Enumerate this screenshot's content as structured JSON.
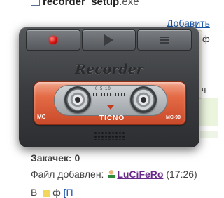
{
  "background_page": {
    "file_name": "recorder_setup",
    "file_ext": ".exe",
    "add_link": "Добавить",
    "fragment_right_1": "ф",
    "fragment_right_2": "ч",
    "downloads_label": "Закачек: 0",
    "added_label": "Файл добавлен:",
    "uploader": "LuCiFeRo",
    "added_time": "(17:26)",
    "bottom_prefix": "В",
    "bottom_mid": "ф",
    "bottom_link": "[П"
  },
  "sidebar": {
    "buttons": [
      {
        "name": "close-icon",
        "glyph": "✕"
      },
      {
        "name": "gear-icon",
        "glyph": "⚙"
      },
      {
        "name": "pin-icon",
        "glyph": "📌"
      },
      {
        "name": "smiley-icon",
        "glyph": "☺"
      }
    ]
  },
  "recorder": {
    "brand": "Recorder",
    "toolbar": {
      "record": "record-icon",
      "play": "play-icon",
      "menu": "menu-icon"
    },
    "cassette": {
      "scale": "0  5  10",
      "label_left": "MC",
      "label_center": "TICNO",
      "label_right": "MC-90"
    }
  },
  "colors": {
    "record_red": "#d41010",
    "cassette_orange": "#e46a45",
    "body_dark": "#3b3d40",
    "link_blue": "#1a56a8",
    "username_purple": "#6a2a8c"
  }
}
